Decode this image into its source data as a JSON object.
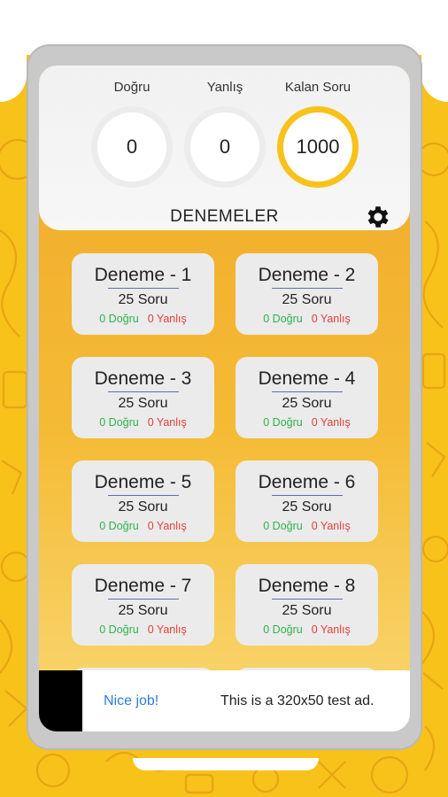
{
  "stats": [
    {
      "label": "Doğru",
      "value": "0"
    },
    {
      "label": "Yanlış",
      "value": "0"
    },
    {
      "label": "Kalan Soru",
      "value": "1000"
    }
  ],
  "section_title": "DENEMELER",
  "settings_icon": "gear-icon",
  "tests": [
    {
      "name": "Deneme - 1",
      "questions": "25 Soru",
      "correct": "0 Doğru",
      "wrong": "0 Yanlış"
    },
    {
      "name": "Deneme - 2",
      "questions": "25 Soru",
      "correct": "0 Doğru",
      "wrong": "0 Yanlış"
    },
    {
      "name": "Deneme - 3",
      "questions": "25 Soru",
      "correct": "0 Doğru",
      "wrong": "0 Yanlış"
    },
    {
      "name": "Deneme - 4",
      "questions": "25 Soru",
      "correct": "0 Doğru",
      "wrong": "0 Yanlış"
    },
    {
      "name": "Deneme - 5",
      "questions": "25 Soru",
      "correct": "0 Doğru",
      "wrong": "0 Yanlış"
    },
    {
      "name": "Deneme - 6",
      "questions": "25 Soru",
      "correct": "0 Doğru",
      "wrong": "0 Yanlış"
    },
    {
      "name": "Deneme - 7",
      "questions": "25 Soru",
      "correct": "0 Doğru",
      "wrong": "0 Yanlış"
    },
    {
      "name": "Deneme - 8",
      "questions": "25 Soru",
      "correct": "0 Doğru",
      "wrong": "0 Yanlış"
    }
  ],
  "ad": {
    "title": "Nice job!",
    "message": "This is a 320x50 test ad."
  },
  "colors": {
    "accent": "#f8c21a",
    "correct": "#2fb24a",
    "wrong": "#e2403b",
    "ad_link": "#2b7fd6"
  }
}
